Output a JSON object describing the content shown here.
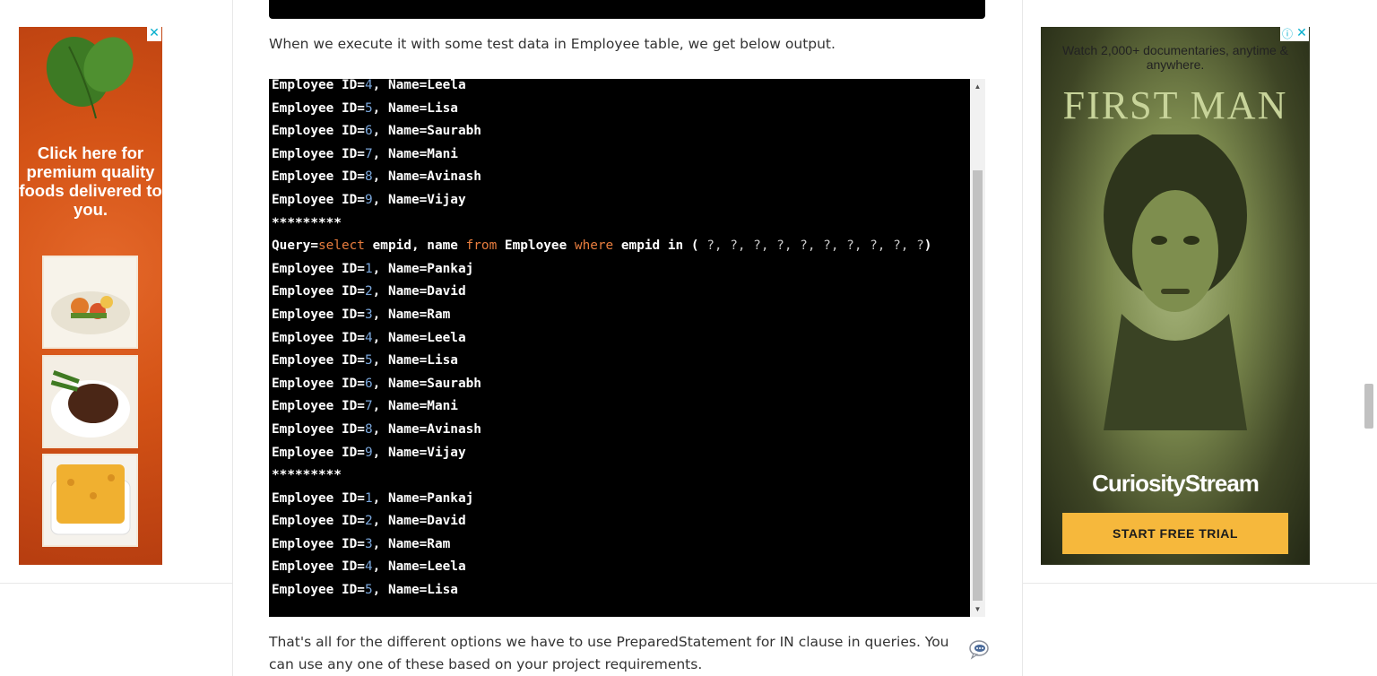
{
  "article": {
    "intro_text": "When we execute it with some test data in Employee table, we get below output.",
    "outro_text": "That's all for the different options we have to use PreparedStatement for IN clause in queries. You can use any one of these based on your project requirements."
  },
  "console": {
    "lines": [
      {
        "type": "emp",
        "id": "4",
        "name": "Leela"
      },
      {
        "type": "emp",
        "id": "5",
        "name": "Lisa"
      },
      {
        "type": "emp",
        "id": "6",
        "name": "Saurabh"
      },
      {
        "type": "emp",
        "id": "7",
        "name": "Mani"
      },
      {
        "type": "emp",
        "id": "8",
        "name": "Avinash"
      },
      {
        "type": "emp",
        "id": "9",
        "name": "Vijay"
      },
      {
        "type": "sep",
        "text": "*********"
      },
      {
        "type": "query",
        "text": "Query=select empid, name from Employee where empid in ( ?, ?, ?, ?, ?, ?, ?, ?, ?, ?)"
      },
      {
        "type": "emp",
        "id": "1",
        "name": "Pankaj"
      },
      {
        "type": "emp",
        "id": "2",
        "name": "David"
      },
      {
        "type": "emp",
        "id": "3",
        "name": "Ram"
      },
      {
        "type": "emp",
        "id": "4",
        "name": "Leela"
      },
      {
        "type": "emp",
        "id": "5",
        "name": "Lisa"
      },
      {
        "type": "emp",
        "id": "6",
        "name": "Saurabh"
      },
      {
        "type": "emp",
        "id": "7",
        "name": "Mani"
      },
      {
        "type": "emp",
        "id": "8",
        "name": "Avinash"
      },
      {
        "type": "emp",
        "id": "9",
        "name": "Vijay"
      },
      {
        "type": "sep",
        "text": "*********"
      },
      {
        "type": "emp",
        "id": "1",
        "name": "Pankaj"
      },
      {
        "type": "emp",
        "id": "2",
        "name": "David"
      },
      {
        "type": "emp",
        "id": "3",
        "name": "Ram"
      },
      {
        "type": "emp",
        "id": "4",
        "name": "Leela"
      },
      {
        "type": "emp",
        "id": "5",
        "name": "Lisa"
      }
    ],
    "labels": {
      "emp_prefix": "Employee ID=",
      "name_prefix": ", Name=",
      "query_prefix": "Query=",
      "kw_select": "select",
      "kw_from": "from",
      "kw_where": "where",
      "cols": " empid, name ",
      "table": " Employee ",
      "in_clause": " empid in ( ",
      "params": "?, ?, ?, ?, ?, ?, ?, ?, ?, ?",
      "close": ")"
    }
  },
  "ads": {
    "left": {
      "text": "Click here for premium quality foods delivered to you.",
      "close_glyph": "✕"
    },
    "right": {
      "tagline": "Watch 2,000+ documentaries, anytime & anywhere.",
      "title": "FIRST MAN",
      "brand": "CuriosityStream",
      "cta": "START FREE TRIAL",
      "info_glyph": "ⓘ",
      "close_glyph": "✕"
    }
  },
  "icons": {
    "chat": "chat-bubble-icon",
    "scroll_up": "▲",
    "scroll_down": "▼"
  },
  "colors": {
    "console_bg": "#000000",
    "number": "#7aa6da",
    "keyword": "#e87d3e",
    "cta": "#f6b83c"
  }
}
